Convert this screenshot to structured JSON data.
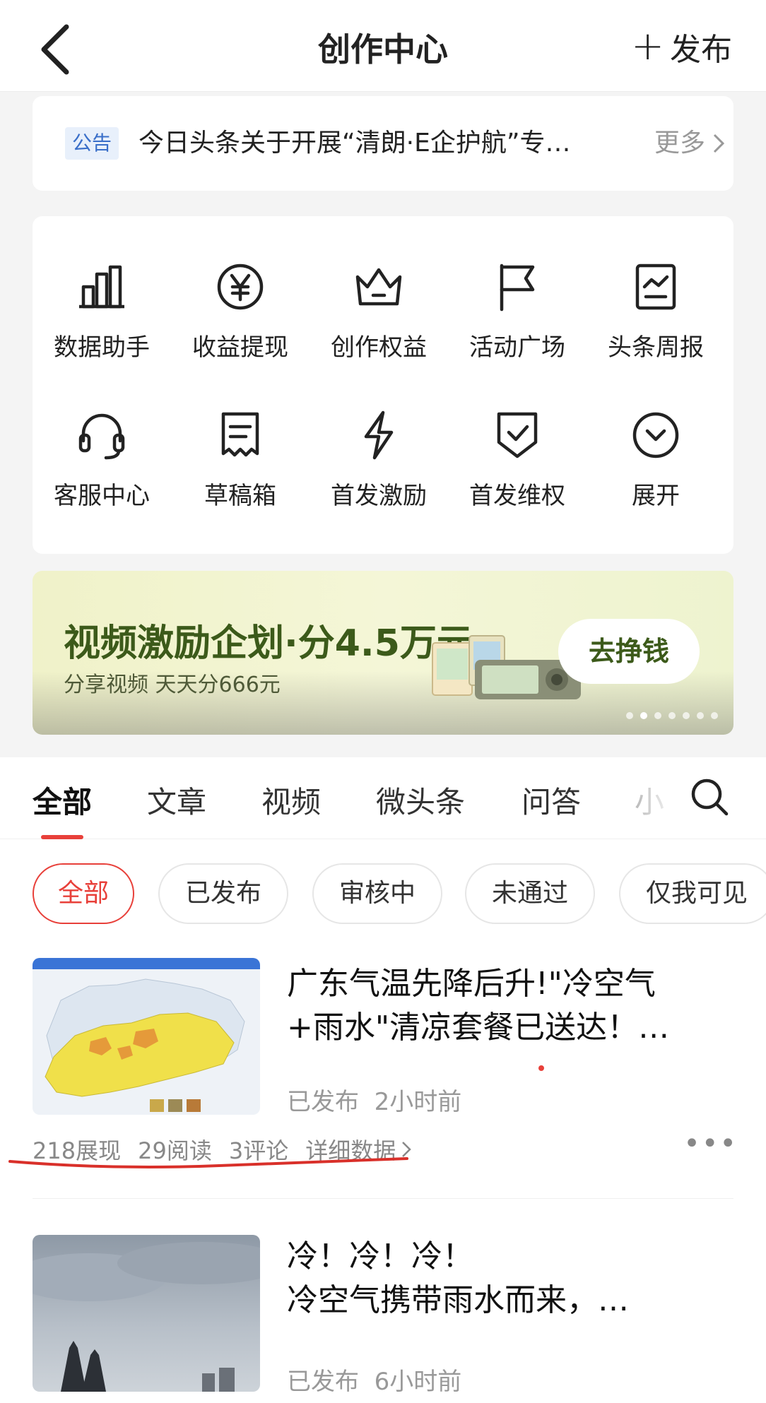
{
  "nav": {
    "title": "创作中心",
    "publish_label": "发布",
    "plus": "+"
  },
  "notice": {
    "tag": "公告",
    "text": "今日头条关于开展“清朗·E企护航”专…",
    "more": "更多"
  },
  "tools": [
    {
      "label": "数据助手",
      "icon": "bar-chart-icon"
    },
    {
      "label": "收益提现",
      "icon": "yuan-icon"
    },
    {
      "label": "创作权益",
      "icon": "crown-icon"
    },
    {
      "label": "活动广场",
      "icon": "flag-icon"
    },
    {
      "label": "头条周报",
      "icon": "report-icon"
    },
    {
      "label": "客服中心",
      "icon": "headset-icon"
    },
    {
      "label": "草稿箱",
      "icon": "draft-icon"
    },
    {
      "label": "首发激励",
      "icon": "lightning-icon"
    },
    {
      "label": "首发维权",
      "icon": "shield-check-icon"
    },
    {
      "label": "展开",
      "icon": "expand-icon"
    }
  ],
  "banner": {
    "headline": "视频激励企划·分4.5万元",
    "sub": "分享视频 天天分666元",
    "button": "去挣钱",
    "slide_count": 7,
    "active_slide": 2
  },
  "tabs": [
    "全部",
    "文章",
    "视频",
    "微头条",
    "问答",
    "小"
  ],
  "filters": [
    "全部",
    "已发布",
    "审核中",
    "未通过",
    "仅我可见"
  ],
  "items": [
    {
      "title_line1": "广东气温先降后升!\"冷空气",
      "title_line2": "+雨水\"清凉套餐已送达！…",
      "status": "已发布",
      "time": "2小时前",
      "stats": {
        "views": "218展现",
        "reads": "29阅读",
        "comments": "3评论",
        "detail": "详细数据"
      }
    },
    {
      "title_line1": "冷！冷！冷！",
      "title_line2": "冷空气携带雨水而来，…",
      "status": "已发布",
      "time": "6小时前"
    }
  ],
  "colors": {
    "accent": "#e8403a",
    "notice_tag": "#3a6fc9",
    "banner_text": "#3c5a1a"
  }
}
